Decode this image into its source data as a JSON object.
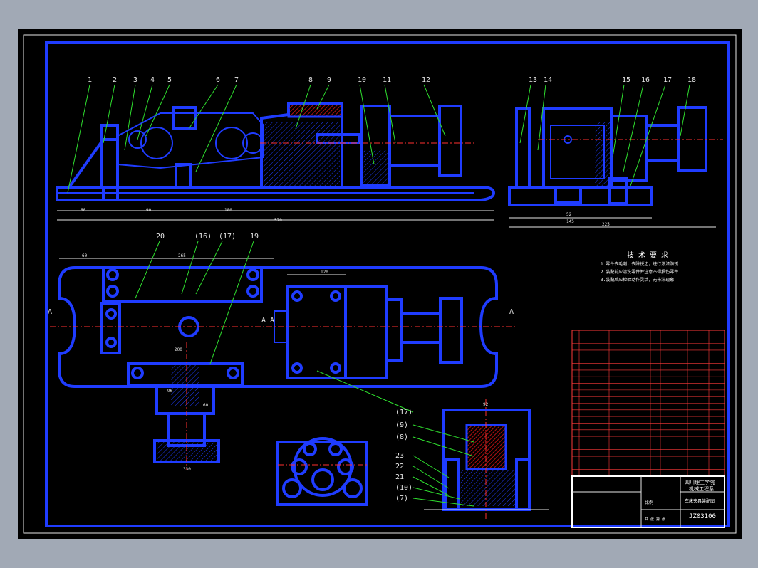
{
  "drawing": {
    "part_labels_top": [
      "1",
      "2",
      "3",
      "4",
      "5",
      "6",
      "7",
      "8",
      "9",
      "10",
      "11",
      "12",
      "13",
      "14",
      "15",
      "16",
      "17",
      "18"
    ],
    "part_labels_mid": [
      "20",
      "(16)",
      "(17)",
      "19"
    ],
    "part_labels_bottom": [
      "(17)",
      "(9)",
      "(8)",
      "23",
      "22",
      "21",
      "(10)",
      "(7)"
    ],
    "section_marks": [
      "A",
      "A",
      "A",
      "A"
    ],
    "dims_top": [
      "60",
      "90",
      "180",
      "570"
    ],
    "dims_right": [
      "52",
      "145",
      "225"
    ],
    "dims_misc": [
      "60",
      "265",
      "120",
      "200",
      "96",
      "60",
      "92",
      "330"
    ],
    "tech_title": "技 术 要 求",
    "tech_lines": [
      "1.零件去毛刺，去除锐边，进行涂漆防锈",
      "2.装配前应清洗零件并注意不得损伤零件",
      "3.装配后应检验动作灵活，无卡滞现象"
    ]
  },
  "title_block": {
    "school": "四川理工学院",
    "dept": "机械工程系",
    "drawing_name": "车床夹具装配图",
    "drawing_number": "JZ03100",
    "scale_label": "比例",
    "sheet_label": "共 张 第 张"
  },
  "colors": {
    "outline": "#1f3cff",
    "leader": "#2fe02f",
    "dimension": "#e6e6e6",
    "center": "#ff3030",
    "table_text": "#ff3a3a"
  }
}
